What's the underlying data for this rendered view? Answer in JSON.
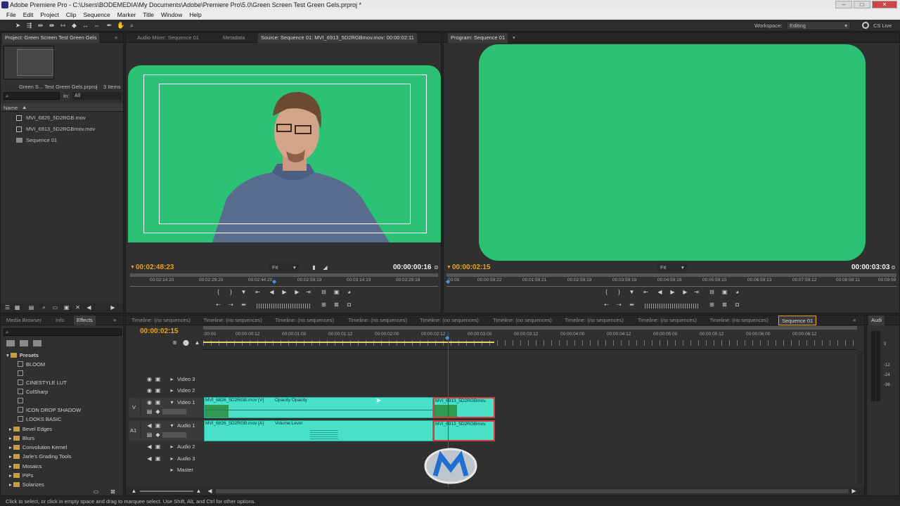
{
  "window": {
    "title": "Adobe Premiere Pro - C:\\Users\\BODEMEDIA\\My Documents\\Adobe\\Premiere Pro\\5.0\\Green Screen Test Green Gels.prproj *"
  },
  "menu": [
    "File",
    "Edit",
    "Project",
    "Clip",
    "Sequence",
    "Marker",
    "Title",
    "Window",
    "Help"
  ],
  "workspace": {
    "label": "Workspace:",
    "value": "Editing",
    "cslive": "CS Live"
  },
  "project": {
    "tab": "Project: Green Screen Test Green Gels",
    "name": "Green S... Test Green Gels.prproj",
    "count": "3 Items",
    "in_label": "In:",
    "in_value": "All",
    "col_name": "Name",
    "items": [
      "MVI_6826_5D2RGB.mov",
      "MVI_6913_5D2RGBmov.mov",
      "Sequence 01"
    ]
  },
  "source": {
    "tabs": [
      "Audio Mixer: Sequence 01",
      "Metadata",
      "Source: Sequence 01: MVI_6913_5D2RGBmov.mov: 00:00:02:11"
    ],
    "timecode": "00:02:48:23",
    "fit": "Fit",
    "duration": "00:00:00:16",
    "ruler": [
      "00:02:14:20",
      "00:02:29:20",
      "00:02:44:20",
      "00:02:59:19",
      "00:03:14:19",
      "00:03:29:18"
    ]
  },
  "program": {
    "tab": "Program: Sequence 01",
    "timecode": "00:00:02:15",
    "fit": "Fit",
    "duration": "00:00:03:03",
    "ruler": [
      "00:00",
      "00:00:59:22",
      "00:01:59:21",
      "00:02:59:19",
      "00:03:59:18",
      "00:04:59:16",
      "00:05:59:15",
      "00:06:59:13",
      "00:07:59:12",
      "00:08:59:11",
      "00:09:59"
    ]
  },
  "effects": {
    "tabs": [
      "Media Browser",
      "Info",
      "Effects"
    ],
    "presets_label": "Presets",
    "items": [
      "BLOOM",
      "",
      "CINESTYLE LUT",
      "ColSharp",
      "",
      "ICON DROP SHADOW",
      "LOOKS BASIC"
    ],
    "folders": [
      "Bevel Edges",
      "Blurs",
      "Convolution Kernel",
      "Jarle's Grading Tools",
      "Mosaics",
      "PiPs",
      "Solarizes"
    ]
  },
  "timeline": {
    "tabs": [
      "Timeline: (no sequences)",
      "Timeline: (no sequences)",
      "Timeline: (no sequences)",
      "Timeline: (no sequences)",
      "Timeline: (no sequences)",
      "Timeline: (no sequences)",
      "Timeline: (no sequences)",
      "Timeline: (no sequences)",
      "Timeline: (no sequences)",
      "Sequence 01"
    ],
    "timecode": "00:00:02:15",
    "ruler": [
      ":00:00",
      "00:00:00:12",
      "00:00:01:00",
      "00:00:01:12",
      "00:00:02:00",
      "00:00:02:12",
      "00:00:03:00",
      "00:00:03:12",
      "00:00:04:00",
      "00:00:04:12",
      "00:00:05:00",
      "00:00:05:12",
      "00:00:06:00",
      "00:00:06:12"
    ],
    "tracks": {
      "video3": "Video 3",
      "video2": "Video 2",
      "video1": "Video 1",
      "audio1": "Audio 1",
      "audio2": "Audio 2",
      "audio3": "Audio 3",
      "master": "Master",
      "v_label": "V",
      "a_label": "A1"
    },
    "clips": {
      "v1a": "MVI_6826_5D2RGB.mov [V]",
      "v1a_fx": "Opacity:Opacity",
      "v1b": "MVI_6913_5D2RGBmov.",
      "a1a": "MVI_6826_5D2RGB.mov [A]",
      "a1a_fx": "Volume:Level",
      "a1b": "MVI_6913_5D2RGBmov."
    }
  },
  "audio_meter": {
    "tab": "Audi",
    "levels": [
      "0",
      "-12",
      "-24",
      "-36"
    ]
  },
  "status": "Click to select, or click in empty space and drag to marquee select. Use Shift, Alt, and Ctrl for other options.",
  "colors": {
    "green_screen": "#2cc276",
    "clip": "#48e0c9",
    "playhead": "#d11e1e",
    "timecode": "#e8a317"
  }
}
